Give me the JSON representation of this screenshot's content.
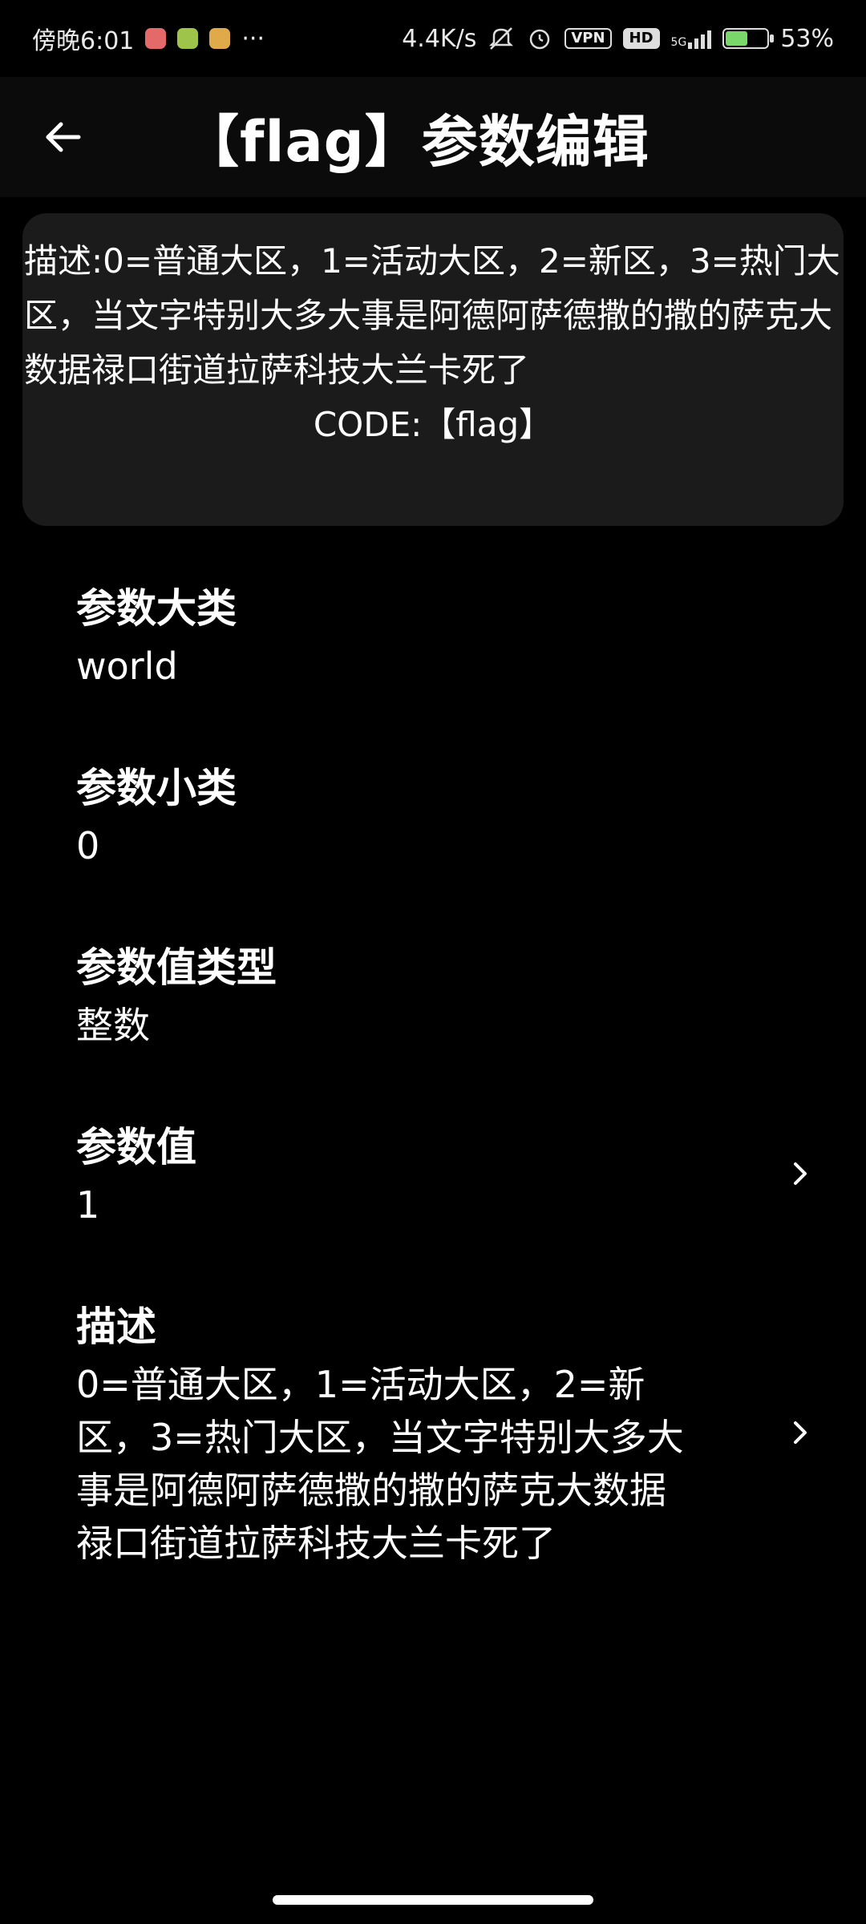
{
  "status_bar": {
    "time": "傍晚6:01",
    "more": "···",
    "net_speed": "4.4K/s",
    "vpn": "VPN",
    "hd": "HD",
    "net_type": "5G",
    "battery": "53%",
    "battery_level": 0.53
  },
  "header": {
    "title": "【flag】参数编辑"
  },
  "desc_card": {
    "text": "描述:0=普通大区，1=活动大区，2=新区，3=热门大区，当文字特别大多大事是阿德阿萨德撒的撒的萨克大数据禄口街道拉萨科技大兰卡死了",
    "code": "CODE:【flag】"
  },
  "fields": [
    {
      "label": "参数大类",
      "value": "world"
    },
    {
      "label": "参数小类",
      "value": "0"
    },
    {
      "label": "参数值类型",
      "value": "整数"
    },
    {
      "label": "参数值",
      "value": "1"
    },
    {
      "label": "描述",
      "value": "0=普通大区，1=活动大区，2=新区，3=热门大区，当文字特别大多大事是阿德阿萨德撒的撒的萨克大数据禄口街道拉萨科技大兰卡死了"
    }
  ],
  "colors": {
    "background": "#000000",
    "card": "#1b1b1b",
    "text": "#ffffff"
  }
}
